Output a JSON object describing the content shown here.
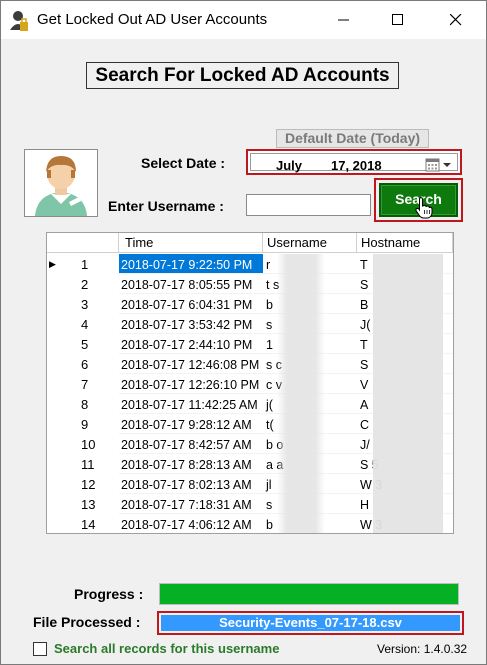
{
  "window": {
    "title": "Get Locked Out AD User Accounts"
  },
  "heading": "Search For Locked AD Accounts",
  "default_date_button": "Default Date (Today)",
  "select_date": {
    "label": "Select Date :",
    "month": "July",
    "day_year": "17, 2018"
  },
  "username": {
    "label": "Enter Username :",
    "value": ""
  },
  "search_button": "Search",
  "grid": {
    "columns": [
      "Time",
      "Username",
      "Hostname"
    ],
    "rows": [
      {
        "n": "1",
        "time": "2018-07-17 9:22:50 PM",
        "user": "r",
        "host": "T"
      },
      {
        "n": "2",
        "time": "2018-07-17 8:05:55 PM",
        "user": "t           s",
        "host": "S"
      },
      {
        "n": "3",
        "time": "2018-07-17 6:04:31 PM",
        "user": "b",
        "host": "B"
      },
      {
        "n": "4",
        "time": "2018-07-17 3:53:42 PM",
        "user": "s",
        "host": "J("
      },
      {
        "n": "5",
        "time": "2018-07-17 2:44:10 PM",
        "user": "1",
        "host": "T"
      },
      {
        "n": "6",
        "time": "2018-07-17 12:46:08 PM",
        "user": "s           c",
        "host": "S"
      },
      {
        "n": "7",
        "time": "2018-07-17 12:26:10 PM",
        "user": "c           v",
        "host": "V"
      },
      {
        "n": "8",
        "time": "2018-07-17 11:42:25 AM",
        "user": "j(",
        "host": "A"
      },
      {
        "n": "9",
        "time": "2018-07-17 9:28:12 AM",
        "user": "t(",
        "host": "C"
      },
      {
        "n": "10",
        "time": "2018-07-17 8:42:57 AM",
        "user": "b           o",
        "host": "J/"
      },
      {
        "n": "11",
        "time": "2018-07-17 8:28:13 AM",
        "user": "a           a",
        "host": "S                 5"
      },
      {
        "n": "12",
        "time": "2018-07-17 8:02:13 AM",
        "user": "jl",
        "host": "W                 3"
      },
      {
        "n": "13",
        "time": "2018-07-17 7:18:31 AM",
        "user": "s",
        "host": "H"
      },
      {
        "n": "14",
        "time": "2018-07-17 4:06:12 AM",
        "user": "b",
        "host": "W                 3"
      }
    ]
  },
  "progress": {
    "label": "Progress :",
    "value_percent": 100
  },
  "file_processed": {
    "label": "File Processed :",
    "value": "Security-Events_07-17-18.csv"
  },
  "search_all": {
    "label": "Search all records for this username",
    "checked": false
  },
  "version": "Version: 1.4.0.32",
  "colors": {
    "highlight_red": "#c0171d",
    "search_green": "#0e7a0e",
    "progress_green": "#06b025",
    "file_blue": "#3399ff",
    "selection_blue": "#0078d7"
  }
}
